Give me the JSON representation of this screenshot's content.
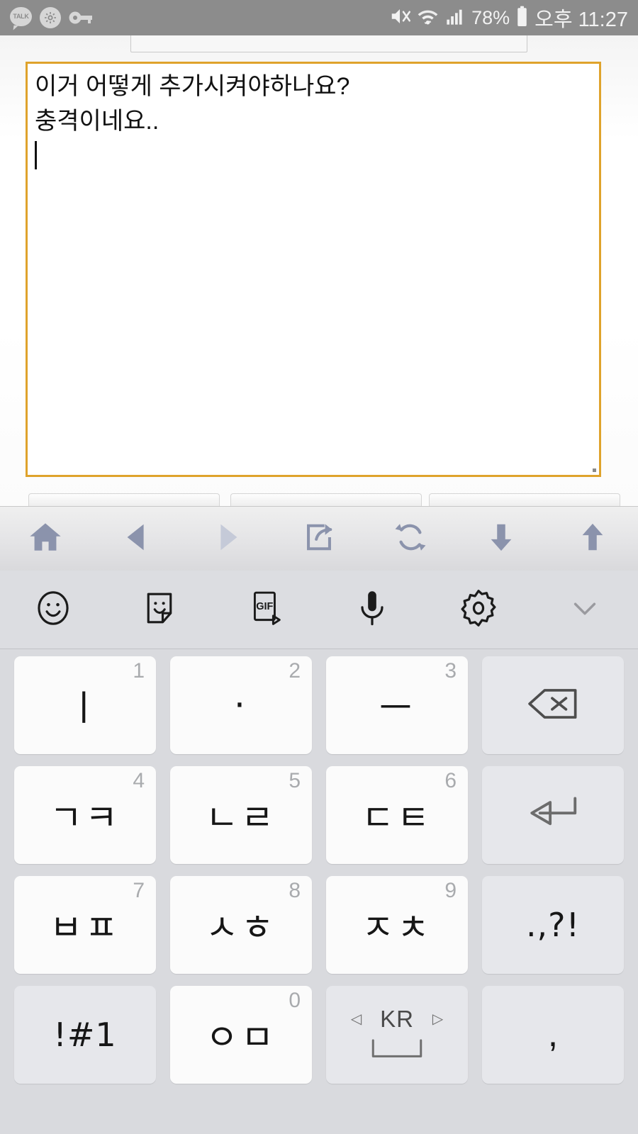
{
  "status_bar": {
    "left_icons": [
      {
        "name": "kakaotalk-icon",
        "label": "TALK"
      },
      {
        "name": "settings-gear-icon",
        "label": ""
      },
      {
        "name": "vpn-key-icon",
        "label": ""
      }
    ],
    "mute_icon": "mute-icon",
    "wifi_icon": "wifi-icon",
    "signal_icon": "cellular-signal-icon",
    "battery_percent": "78%",
    "battery_icon": "battery-icon",
    "time": "오후 11:27"
  },
  "page": {
    "ghost_field_value": "",
    "textarea": {
      "lines": [
        "이거 어떻게 추가시켜야하나요?",
        "충격이네요.."
      ],
      "caret_visible": true,
      "border_color": "#dfa32c"
    }
  },
  "browser_toolbar": {
    "buttons": [
      {
        "name": "home-button",
        "icon": "home-icon",
        "enabled": true
      },
      {
        "name": "back-button",
        "icon": "back-arrow-icon",
        "enabled": true
      },
      {
        "name": "forward-button",
        "icon": "forward-arrow-icon",
        "enabled": false
      },
      {
        "name": "share-button",
        "icon": "share-icon",
        "enabled": true
      },
      {
        "name": "refresh-button",
        "icon": "refresh-icon",
        "enabled": true
      },
      {
        "name": "scroll-down-button",
        "icon": "down-arrow-icon",
        "enabled": true
      },
      {
        "name": "scroll-up-button",
        "icon": "up-arrow-icon",
        "enabled": true
      }
    ],
    "icon_color": "#8b93ac",
    "icon_color_disabled": "#c5cad8"
  },
  "keyboard_toolbar": {
    "buttons": [
      {
        "name": "emoji-button",
        "icon": "smiley-icon"
      },
      {
        "name": "sticker-button",
        "icon": "sticker-icon"
      },
      {
        "name": "gif-button",
        "icon": "gif-icon",
        "label": "GIF"
      },
      {
        "name": "voice-input-button",
        "icon": "microphone-icon"
      },
      {
        "name": "keyboard-settings-button",
        "icon": "gear-icon"
      },
      {
        "name": "hide-keyboard-button",
        "icon": "chevron-down-icon"
      }
    ]
  },
  "keyboard": {
    "layout_name": "cheonjiin",
    "language": "KR",
    "rows": [
      [
        {
          "name": "key-i",
          "glyph": "ㅣ",
          "num": "1",
          "type": "letter"
        },
        {
          "name": "key-dot",
          "glyph": "·",
          "num": "2",
          "type": "letter"
        },
        {
          "name": "key-eu",
          "glyph": "ㅡ",
          "num": "3",
          "type": "letter"
        },
        {
          "name": "backspace-key",
          "glyph": "",
          "num": "",
          "type": "func",
          "icon": "backspace-icon"
        }
      ],
      [
        {
          "name": "key-giyeok-kieuk",
          "glyph": "ㄱㅋ",
          "num": "4",
          "type": "letter"
        },
        {
          "name": "key-nieun-rieul",
          "glyph": "ㄴㄹ",
          "num": "5",
          "type": "letter"
        },
        {
          "name": "key-digeut-tieut",
          "glyph": "ㄷㅌ",
          "num": "6",
          "type": "letter"
        },
        {
          "name": "enter-key",
          "glyph": "",
          "num": "",
          "type": "func",
          "icon": "enter-icon"
        }
      ],
      [
        {
          "name": "key-bieup-pieup",
          "glyph": "ㅂㅍ",
          "num": "7",
          "type": "letter"
        },
        {
          "name": "key-siot-hieut",
          "glyph": "ㅅㅎ",
          "num": "8",
          "type": "letter"
        },
        {
          "name": "key-jieut-chieut",
          "glyph": "ㅈㅊ",
          "num": "9",
          "type": "letter"
        },
        {
          "name": "punctuation-key",
          "glyph": ".,?!",
          "num": "",
          "type": "func"
        }
      ],
      [
        {
          "name": "symbols-key",
          "glyph": "!#1",
          "num": "",
          "type": "func"
        },
        {
          "name": "key-ieung-mieum",
          "glyph": "ㅇㅁ",
          "num": "0",
          "type": "letter"
        },
        {
          "name": "space-key",
          "glyph": "",
          "num": "",
          "type": "func",
          "icon": "space-icon",
          "lang": "KR",
          "left_arrow": "◁",
          "right_arrow": "▷"
        },
        {
          "name": "comma-key",
          "glyph": ",",
          "num": "",
          "type": "func"
        }
      ]
    ]
  },
  "colors": {
    "statusbar_bg": "#8c8c8c",
    "keyboard_bg": "#d9dade",
    "letter_key_bg": "#fbfbfb",
    "func_key_bg": "#e6e7eb",
    "accent_border": "#dfa32c"
  }
}
